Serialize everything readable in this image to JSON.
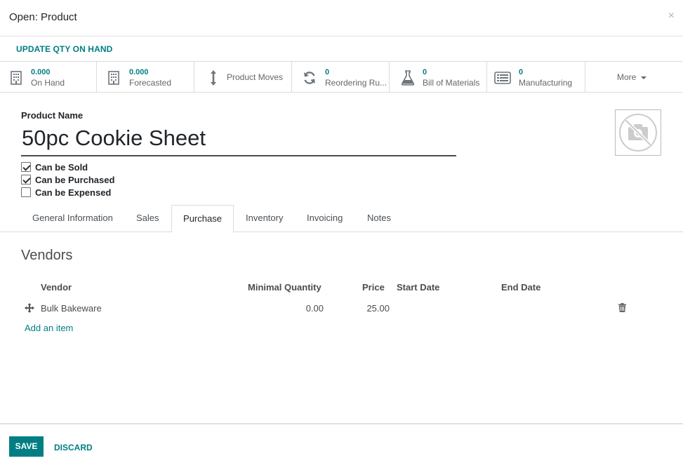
{
  "dialog": {
    "title": "Open: Product",
    "close_label": "×"
  },
  "actions": {
    "update_qty": "UPDATE QTY ON HAND"
  },
  "smart_buttons": [
    {
      "icon": "building-icon",
      "value": "0.000",
      "label": "On Hand"
    },
    {
      "icon": "building-icon",
      "value": "0.000",
      "label": "Forecasted"
    },
    {
      "icon": "arrows-vertical-icon",
      "label": "Product Moves"
    },
    {
      "icon": "refresh-icon",
      "value": "0",
      "label": "Reordering Ru..."
    },
    {
      "icon": "flask-icon",
      "value": "0",
      "label": "Bill of Materials"
    },
    {
      "icon": "list-alt-icon",
      "value": "0",
      "label": "Manufacturing"
    },
    {
      "label": "More"
    }
  ],
  "form": {
    "product_name_label": "Product Name",
    "product_name": "50pc Cookie Sheet",
    "checkboxes": [
      {
        "label": "Can be Sold",
        "checked": true
      },
      {
        "label": "Can be Purchased",
        "checked": true
      },
      {
        "label": "Can be Expensed",
        "checked": false
      }
    ]
  },
  "tabs": [
    {
      "label": "General Information",
      "active": false
    },
    {
      "label": "Sales",
      "active": false
    },
    {
      "label": "Purchase",
      "active": true
    },
    {
      "label": "Inventory",
      "active": false
    },
    {
      "label": "Invoicing",
      "active": false
    },
    {
      "label": "Notes",
      "active": false
    }
  ],
  "vendors": {
    "title": "Vendors",
    "columns": {
      "vendor": "Vendor",
      "min_qty": "Minimal Quantity",
      "price": "Price",
      "start_date": "Start Date",
      "end_date": "End Date"
    },
    "rows": [
      {
        "vendor": "Bulk Bakeware",
        "min_qty": "0.00",
        "price": "25.00",
        "start_date": "",
        "end_date": ""
      }
    ],
    "add_item": "Add an item"
  },
  "footer": {
    "save": "SAVE",
    "discard": "DISCARD"
  },
  "colors": {
    "accent": "#017e84",
    "text": "#4c4c4c"
  }
}
